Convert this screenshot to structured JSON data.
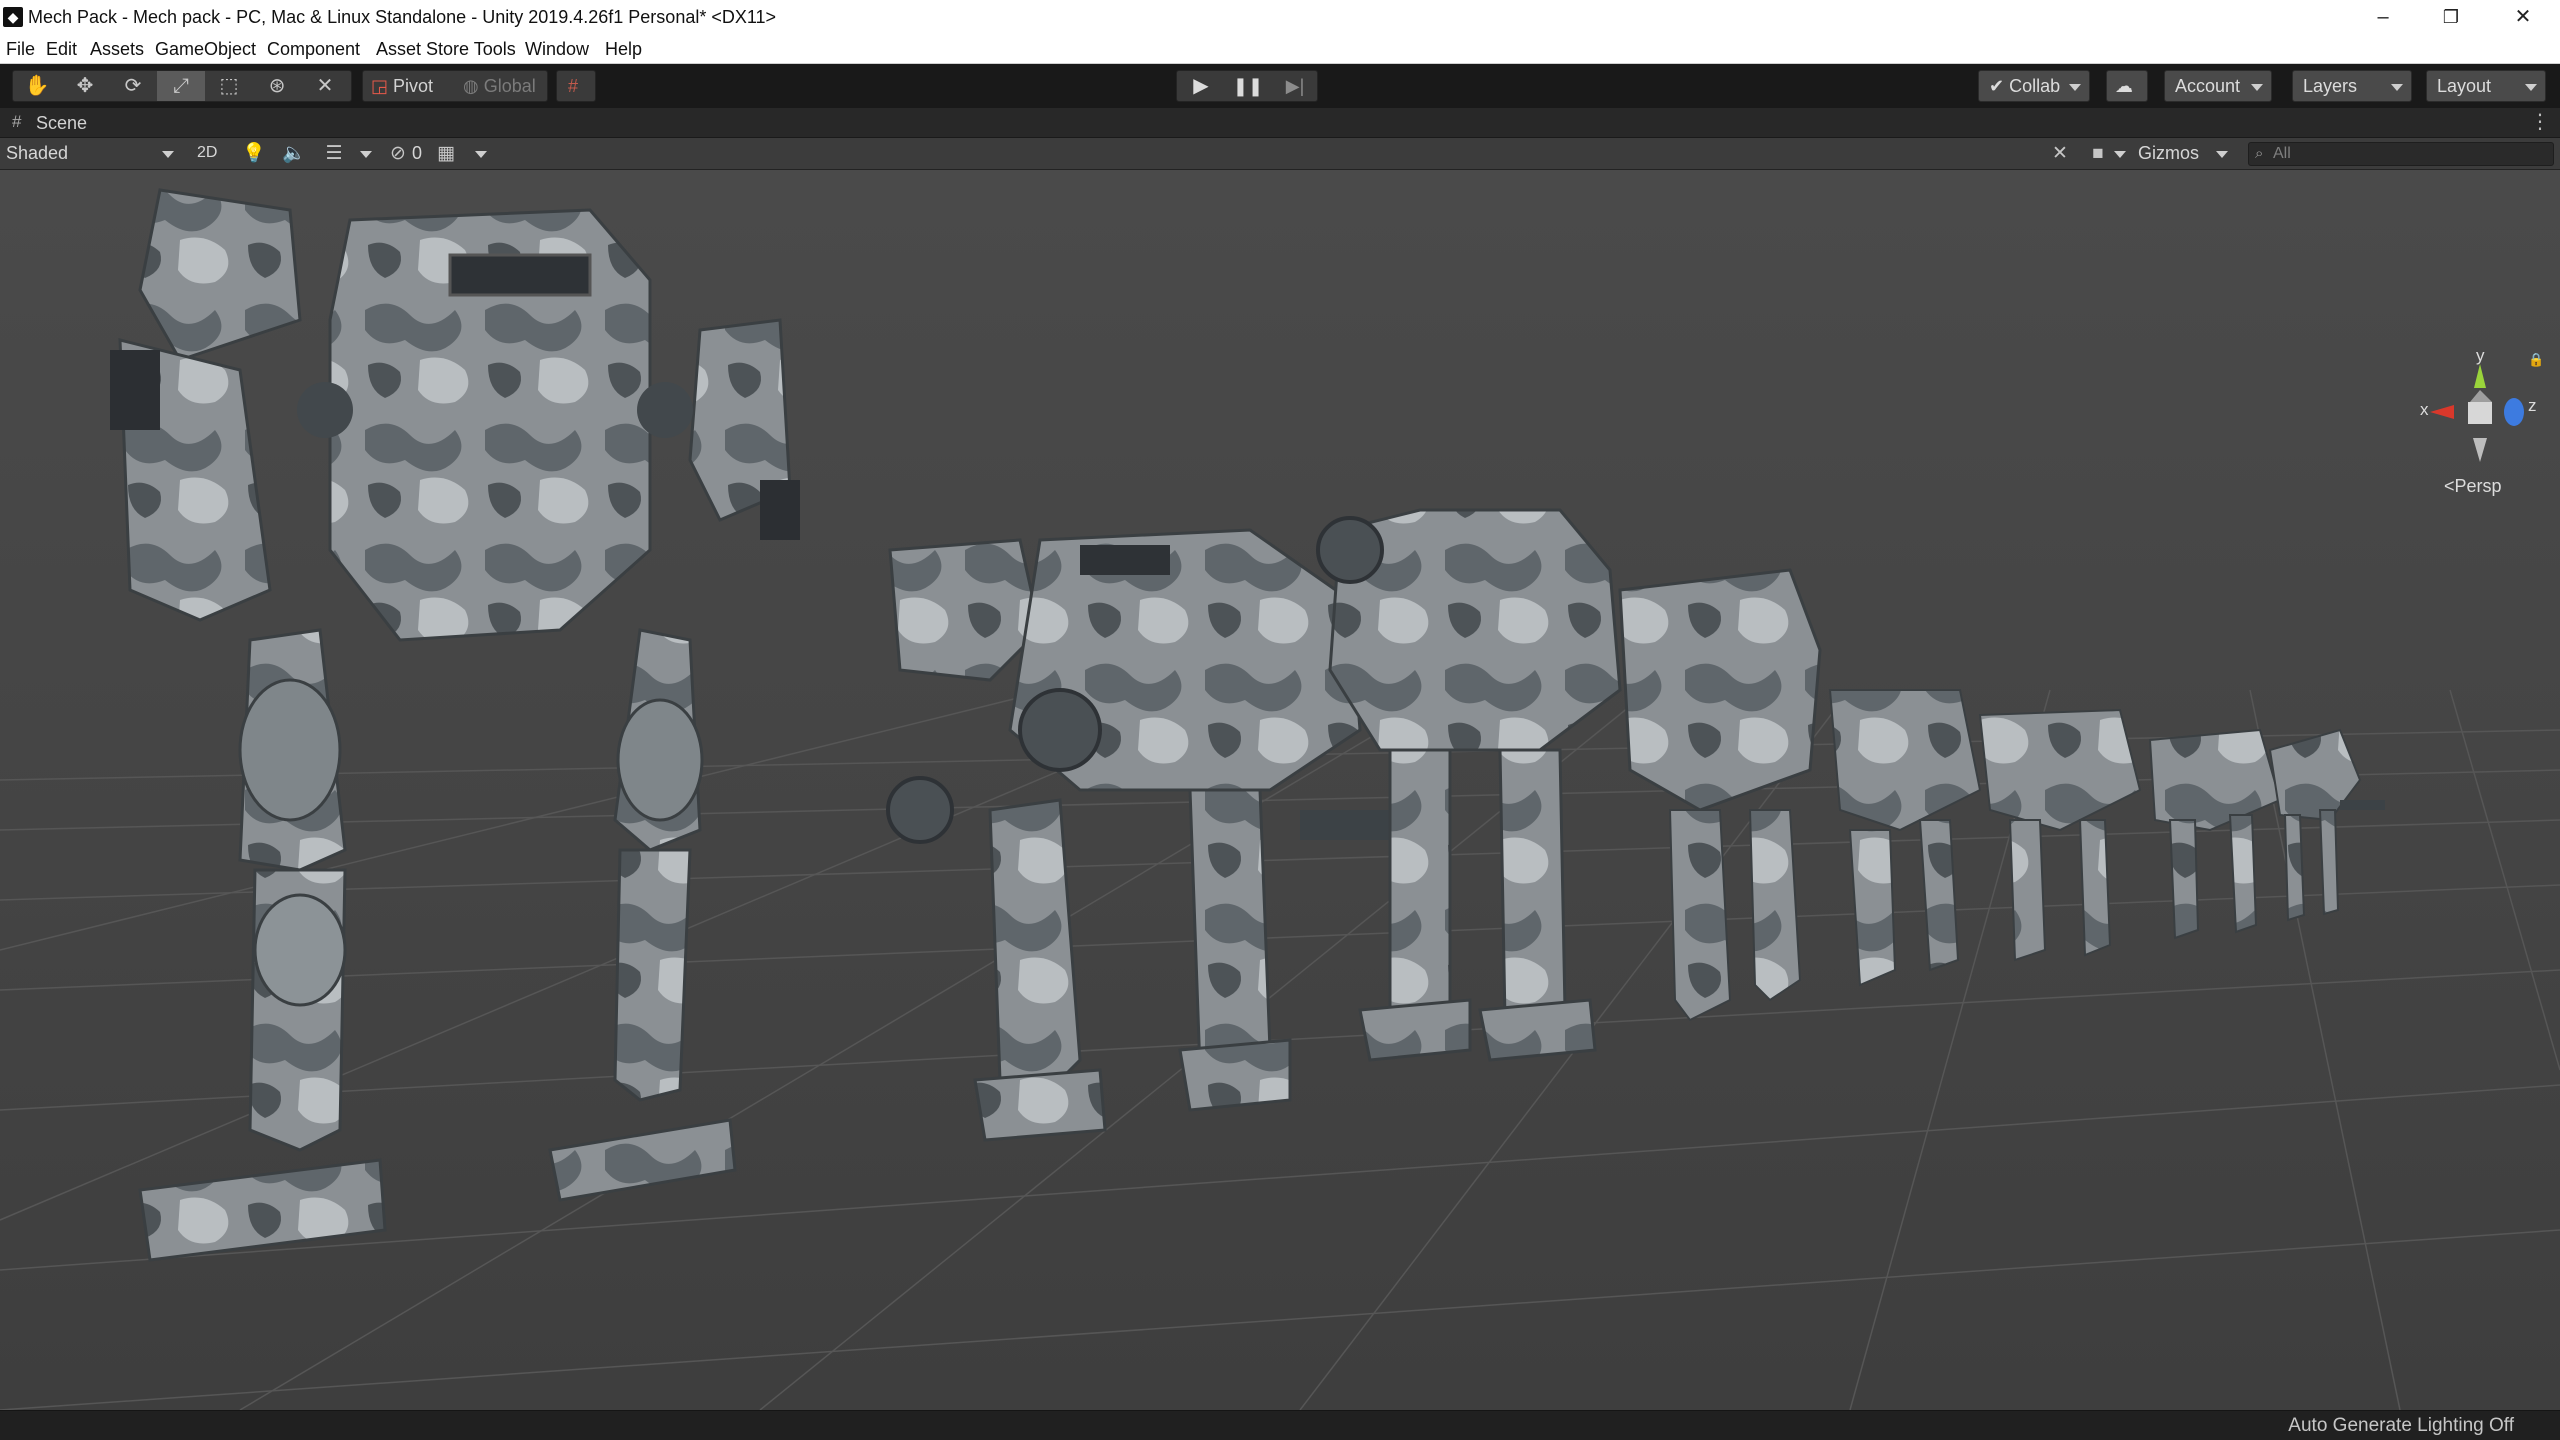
{
  "window": {
    "title": "Mech Pack - Mech pack - PC, Mac & Linux Standalone - Unity 2019.4.26f1 Personal* <DX11>",
    "controls": {
      "minimize": "–",
      "maximize": "❐",
      "close": "✕"
    }
  },
  "menu": [
    "File",
    "Edit",
    "Assets",
    "GameObject",
    "Component",
    "Asset Store Tools",
    "Window",
    "Help"
  ],
  "toolbar": {
    "tools": [
      "hand-tool",
      "move-tool",
      "rotate-tool",
      "scale-tool",
      "rect-tool",
      "transform-tool",
      "custom-tool"
    ],
    "active_tool": "scale-tool",
    "pivot_label": "Pivot",
    "global_label": "Global",
    "collab_label": "Collab",
    "account_label": "Account",
    "layers_label": "Layers",
    "layout_label": "Layout"
  },
  "scene_tab": {
    "label": "Scene"
  },
  "scene_toolbar": {
    "draw_mode": "Shaded",
    "mode_2d": "2D",
    "hidden_count": "0",
    "gizmos_label": "Gizmos",
    "search_placeholder": "All"
  },
  "gizmo": {
    "y_label": "y",
    "x_label": "x",
    "z_label": "z",
    "projection": "Persp"
  },
  "status": {
    "text": "Auto Generate Lighting Off"
  },
  "colors": {
    "viewport_bg": "#474747",
    "grid_line": "#5a5a5a",
    "axis_x": "#d9382b",
    "axis_y": "#9ad43b",
    "axis_z": "#3d7be0"
  }
}
